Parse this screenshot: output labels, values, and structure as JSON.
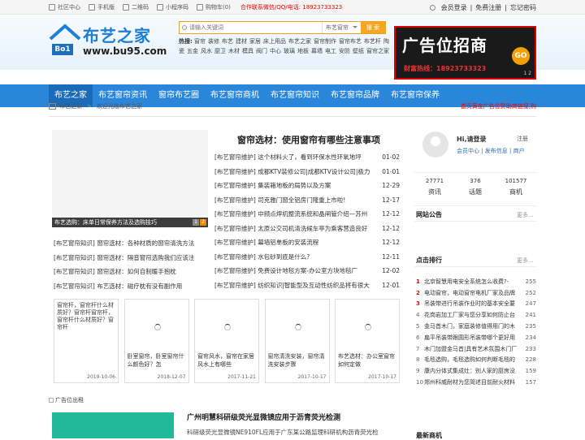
{
  "topbar": {
    "items": [
      "社区中心",
      "手机版",
      "二维码",
      "小程序码",
      "购物车(0)"
    ],
    "hotline": "合作联系微信/QQ/电话: 18923733323",
    "right": [
      "会员登录",
      "免费注册",
      "忘记密码"
    ]
  },
  "logo": {
    "cn": "布艺之家",
    "badge": "Bo1",
    "url": "www.bu95.com"
  },
  "search": {
    "placeholder": "请输入关键词",
    "select": "布艺窗帘",
    "button": "搜 索"
  },
  "hot": {
    "label": "热搜:",
    "words": [
      "窗帘",
      "装修",
      "布艺",
      "建材",
      "家居",
      "床上用品",
      "布艺之家",
      "窗帘制作",
      "窗帘布艺",
      "布艺杆",
      "陶瓷",
      "五金",
      "风水",
      "厨卫",
      "木材",
      "模具",
      "阀门",
      "中心",
      "玻璃",
      "地板",
      "幕墙",
      "电工",
      "安防",
      "壁纸",
      "窗帘之家"
    ]
  },
  "banner": {
    "title": "广告位招商",
    "go": "GO",
    "phone": "财富热线：18923733323",
    "dots": "1 2"
  },
  "nav": [
    "布艺之家",
    "布艺窗帘资讯",
    "窗帘布艺圈",
    "布艺窗帘商机",
    "布艺窗帘知识",
    "布艺窗帘品牌",
    "布艺窗帘保养"
  ],
  "crumb": {
    "home": "布艺之家",
    "sep": ">",
    "welcome": "欢迎光临布艺之家",
    "notice": "首页黄金广告位赞助商链接,购"
  },
  "featured": {
    "caption": "布艺选购：床单日常保养方法及选购技巧",
    "pages": [
      "1",
      "2"
    ]
  },
  "left_list": [
    "[布艺窗帘知识] 窗帘选材：各种材质的窗帘清洗方法",
    "[布艺窗帘知识] 窗帘选材：隔音窗帘选购我们应该注",
    "[布艺窗帘知识] 窗帘选材：如何自制暖手抱枕",
    "[布艺窗帘知识] 布艺选材：磁疗枕有没有副作用"
  ],
  "main_news": {
    "title": "窗帘选材：使用窗帘有哪些注意事项",
    "rows": [
      {
        "t": "[布艺窗帘维护] 这个材料火了，看到环保水性环氧地坪",
        "d": "01-02"
      },
      {
        "t": "[布艺窗帘维护] 成都KTV装修公司|成都KTV设计公司|极力",
        "d": "01-01"
      },
      {
        "t": "[布艺窗帘维护] 集装箱地板的局势以及方案",
        "d": "12-29"
      },
      {
        "t": "[布艺窗帘维护] 司克雅门窗全铝房门隆重上市啦!",
        "d": "12-17"
      },
      {
        "t": "[布艺窗帘维护] 中频点焊机整流系统和晶闸管介绍—苏州",
        "d": "12-12"
      },
      {
        "t": "[布艺窗帘维护] 太原公交司机清洗候车亭为乘客营造良好",
        "d": "12-12"
      },
      {
        "t": "[布艺窗帘维护] 幕墙铝单板的安装流程",
        "d": "12-12"
      },
      {
        "t": "[布艺窗帘维护] 水包砂到底是什么?",
        "d": "12-11"
      },
      {
        "t": "[布艺窗帘维护] 免费设计地毯方案-办公室方块地毯厂",
        "d": "12-02"
      },
      {
        "t": "[布艺窗帘维护] 纺织知识|智能型及互动性纺织品将有很大",
        "d": "12-01"
      }
    ]
  },
  "cards": [
    {
      "img": "窗帘杆，窗帘杆什么材质好？窗帘杆窗帘杆，窗帘杆什么材质好？窗帘杆",
      "text": "",
      "date": "2019-10-06"
    },
    {
      "img": "",
      "text": "卧室窗帘，卧室窗帘什么颜色好？怎",
      "date": "2018-12-07"
    },
    {
      "img": "",
      "text": "窗帘风水，窗帘在家居风水上有哪些",
      "date": "2017-11-21"
    },
    {
      "img": "",
      "text": "窗帘清洗安装，窗帘清洗安装步骤",
      "date": "2017-10-17"
    },
    {
      "img": "",
      "text": "布艺选材：办公室窗帘如何定做",
      "date": "2017-10-17"
    }
  ],
  "ad_label": "广告位出租",
  "news2": {
    "title": "广州明慧科研级荧光显微镜应用于沥青荧光检测",
    "text": "科研级荧光显微镜NE910FL应用于广东某公路监理科研机构沥青荧光检"
  },
  "user": {
    "hi": "Hi,请登录",
    "register": "注册",
    "links": "会员中心 | 发布信息 | 商户"
  },
  "stats": [
    {
      "n": "27771",
      "l": "资讯"
    },
    {
      "n": "376",
      "l": "话题"
    },
    {
      "n": "101577",
      "l": "商机"
    }
  ],
  "sections": {
    "notice": "网站公告",
    "rank": "点击排行",
    "newest": "最新商机",
    "more": "更多..."
  },
  "rank": [
    {
      "n": "1",
      "t": "北京智慧用电安全系统怎么收费?-",
      "c": "255"
    },
    {
      "n": "2",
      "t": "电动窗帘，电动窗帘电机厂家及品牌",
      "c": "252"
    },
    {
      "n": "3",
      "t": "吊装带进行吊装作业时的基本安全要",
      "c": "247"
    },
    {
      "n": "4",
      "t": "花岗岩加工厂家与您分享如何防止台",
      "c": "241"
    },
    {
      "n": "5",
      "t": "金马首木门，家庭装修值得用门的木",
      "c": "235"
    },
    {
      "n": "6",
      "t": "扁平吊装带跟圆形吊装带哪个更好用",
      "c": "234"
    },
    {
      "n": "7",
      "t": "木门加盟金马首|具有艺术氛围木门厂",
      "c": "233"
    },
    {
      "n": "8",
      "t": "毛毯选购，毛毯选购如何判断毛毯的",
      "c": "228"
    },
    {
      "n": "9",
      "t": "康内分体式集成灶：别人家的厨房没",
      "c": "159"
    },
    {
      "n": "10",
      "t": "郑州科威耐材为您简述目前耐火材料",
      "c": "157"
    }
  ]
}
